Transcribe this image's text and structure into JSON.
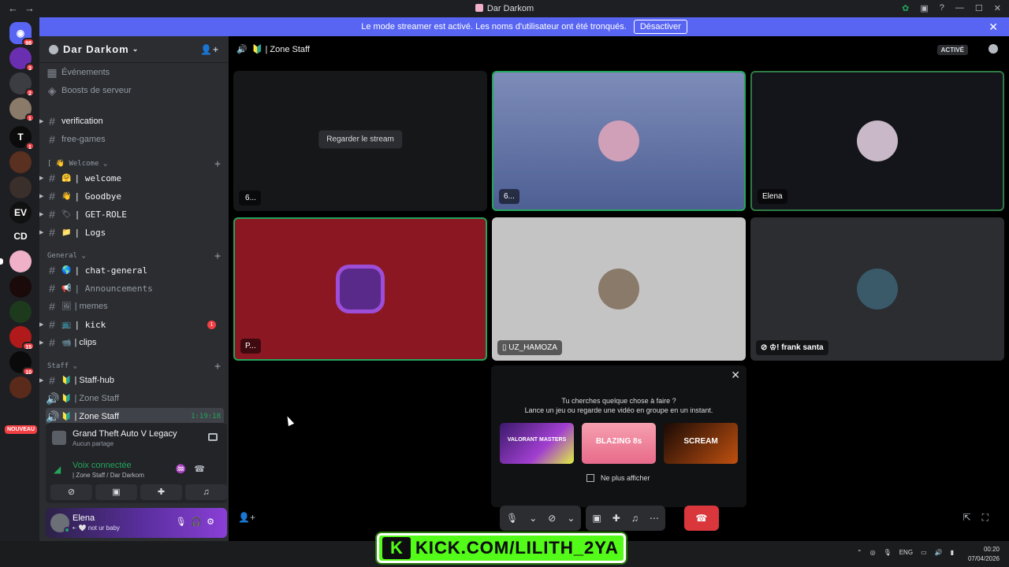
{
  "window": {
    "title": "Dar Darkom"
  },
  "streamer_banner": {
    "text": "Le mode streamer est activé. Les noms d'utilisateur ont été tronqués.",
    "button": "Désactiver"
  },
  "guild_list": {
    "badges": [
      "98",
      "3",
      "2",
      "1",
      "1",
      "1",
      "15",
      "10"
    ],
    "cd_label": "CD",
    "new_label": "NOUVEAU"
  },
  "server": {
    "name": "Dar Darkom"
  },
  "sidebar": {
    "events": "Événements",
    "boosts": "Boosts de serveur",
    "verification": "verification",
    "free_games": "free-games",
    "cat_welcome": "Welcome",
    "welcome": "| welcome",
    "goodbye": "| Goodbye",
    "getrole": "| GET-ROLE",
    "logs": "| Logs",
    "cat_general": "General",
    "chat_general": "| chat-general",
    "announcements": "| Announcements",
    "memes": "| memes",
    "kick": "| kick",
    "kick_badge": "1",
    "clips": "| clips",
    "cat_staff": "Staff",
    "staff_hub": "| Staff-hub",
    "zone_staff_1": "| Zone Staff",
    "zone_staff_2": "| Zone Staff",
    "timer": "1:19:18"
  },
  "activity": {
    "game": "Grand Theft Auto V Legacy",
    "status": "Aucun partage"
  },
  "voice": {
    "title": "Voix connectée",
    "channel": "| Zone Staff / Dar Darkom"
  },
  "user": {
    "name": "Elena",
    "status": "not ur baby"
  },
  "header": {
    "channel": "| Zone Staff",
    "active": "ACTIVÉ"
  },
  "tiles": {
    "watch": "Regarder le stream",
    "t1": " 6...",
    "t2": "6...",
    "t3": "Elena",
    "t4": "P...",
    "t5": "UZ_HAMOZA",
    "t6": "! frank santa"
  },
  "suggest": {
    "q1": "Tu cherches quelque chose à faire ?",
    "q2": "Lance un jeu ou regarde une vidéo en groupe en un instant.",
    "card1": "VALORANT MASTERS",
    "card2": "BLAZING 8s",
    "card3": "SCREAM",
    "dont_show": "Ne plus afficher"
  },
  "taskbar": {
    "lang": "ENG",
    "time": "00:20",
    "date": "07/04/2026"
  },
  "overlay": {
    "kick_url": "KICK.COM/LILITH_2YA"
  },
  "colors": {
    "accent": "#5865f2",
    "green": "#23a55a",
    "red": "#da373c",
    "kick": "#53fc18"
  }
}
